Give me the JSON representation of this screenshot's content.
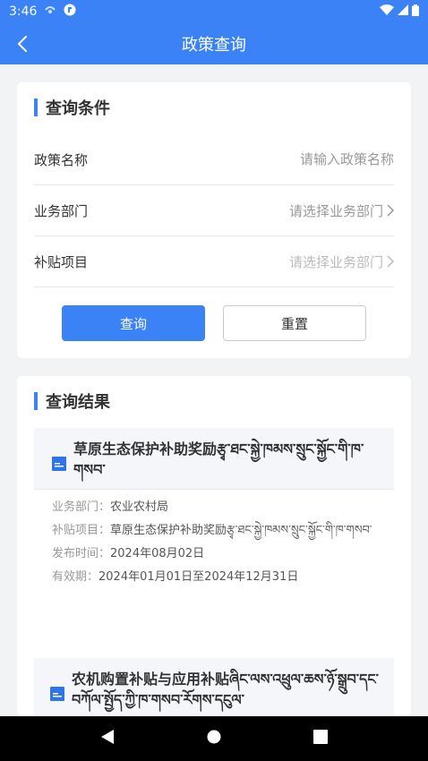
{
  "status_bar": {
    "time": "3:46"
  },
  "app_bar": {
    "title": "政策查询"
  },
  "query": {
    "section_title": "查询条件",
    "fields": [
      {
        "label": "政策名称",
        "placeholder": "请输入政策名称"
      },
      {
        "label": "业务部门",
        "value": "请选择业务部门"
      },
      {
        "label": "补贴项目",
        "value": "请选择业务部门"
      }
    ],
    "search_label": "查询",
    "reset_label": "重置"
  },
  "results": {
    "section_title": "查询结果",
    "items": [
      {
        "title": "草原生态保护补助奖励རྩྭ་ཐང་སྐྱེ་ཁམས་སྲུང་སྐྱོང་གི་ཁ་གསབ་",
        "dept_key": "业务部门：",
        "dept": "农业农村局",
        "proj_key": "补贴项目：",
        "proj": "草原生态保护补助奖励རྩྭ་ཐང་སྐྱེ་ཁམས་སྲུང་སྐྱོང་གི་ཁ་གསབ་",
        "date_key": "发布时间：",
        "date": "2024年08月02日",
        "valid_key": "有效期：",
        "valid": "2024年01月01日至2024年12月31日"
      },
      {
        "title": "农机购置补贴与应用补贴ཞིང་ལས་འཕྲུལ་ཆས་ཉོ་སྒྲུབ་དང་བཀོལ་སྤྱོད་ཀྱི་ཁ་གསབ་རོགས་དངུལ་"
      }
    ]
  }
}
